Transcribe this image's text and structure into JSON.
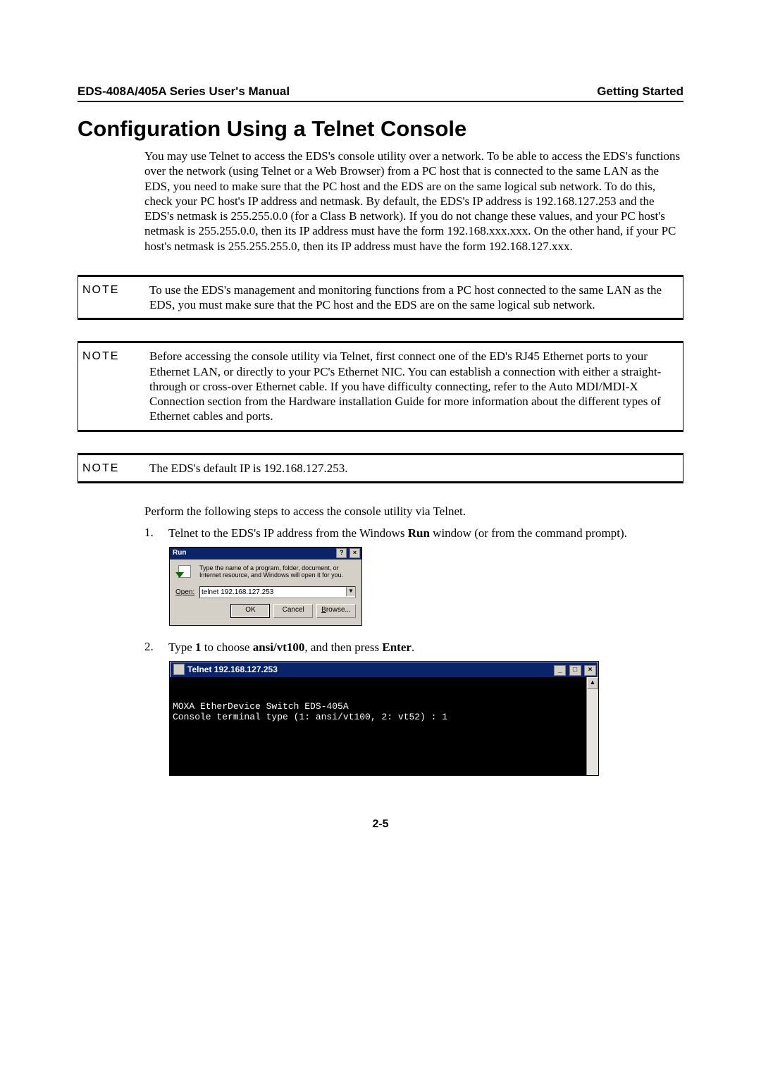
{
  "header": {
    "left": "EDS-408A/405A Series User's Manual",
    "right": "Getting Started"
  },
  "heading": "Configuration Using a Telnet Console",
  "intro": "You may use Telnet to access the EDS's console utility over a network. To be able to access the EDS's functions over the network (using Telnet or a Web Browser) from a PC host that is connected to the same LAN as the EDS, you need to make sure that the PC host and the EDS are on the same logical sub network. To do this, check your PC host's IP address and netmask. By default, the EDS's IP address is 192.168.127.253 and the EDS's netmask is 255.255.0.0 (for a Class B network). If you do not change these values, and your PC host's netmask is 255.255.0.0, then its IP address must have the form 192.168.xxx.xxx. On the other hand, if your PC host's netmask is 255.255.255.0, then its IP address must have the form 192.168.127.xxx.",
  "note_label": "NOTE",
  "note1": "To use the EDS's management and monitoring functions from a PC host connected to the same LAN as the EDS, you must make sure that the PC host and the EDS are on the same logical sub network.",
  "note2": "Before accessing the console utility via Telnet, first connect one of the ED's RJ45 Ethernet ports to your Ethernet LAN, or directly to your PC's Ethernet NIC. You can establish a connection with either a straight-through or cross-over Ethernet cable. If you have difficulty connecting, refer to the Auto MDI/MDI-X Connection section from the Hardware installation Guide for more information about the different types of Ethernet cables and ports.",
  "note3": "The EDS's default IP is 192.168.127.253.",
  "steps_intro": "Perform the following steps to access the console utility via Telnet.",
  "step1_num": "1.",
  "step1_a": "Telnet to the EDS's IP address from the Windows ",
  "step1_b": "Run",
  "step1_c": " window (or from the command prompt).",
  "step2_num": "2.",
  "step2_a": "Type ",
  "step2_b": "1",
  "step2_c": " to choose ",
  "step2_d": "ansi/vt100",
  "step2_e": ", and then press ",
  "step2_f": "Enter",
  "step2_g": ".",
  "run_dialog": {
    "title": "Run",
    "help": "?",
    "close": "×",
    "desc": "Type the name of a program, folder, document, or Internet resource, and Windows will open it for you.",
    "open_label": "Open:",
    "input_value": "telnet 192.168.127.253",
    "btn_ok": "OK",
    "btn_cancel": "Cancel",
    "btn_browse": "Browse..."
  },
  "telnet": {
    "title": "Telnet 192.168.127.253",
    "min": "_",
    "max": "□",
    "close": "×",
    "line1": "MOXA EtherDevice Switch EDS-405A",
    "line2": "Console terminal type (1: ansi/vt100, 2: vt52) : 1",
    "scroll_up": "▲"
  },
  "page_num": "2-5"
}
